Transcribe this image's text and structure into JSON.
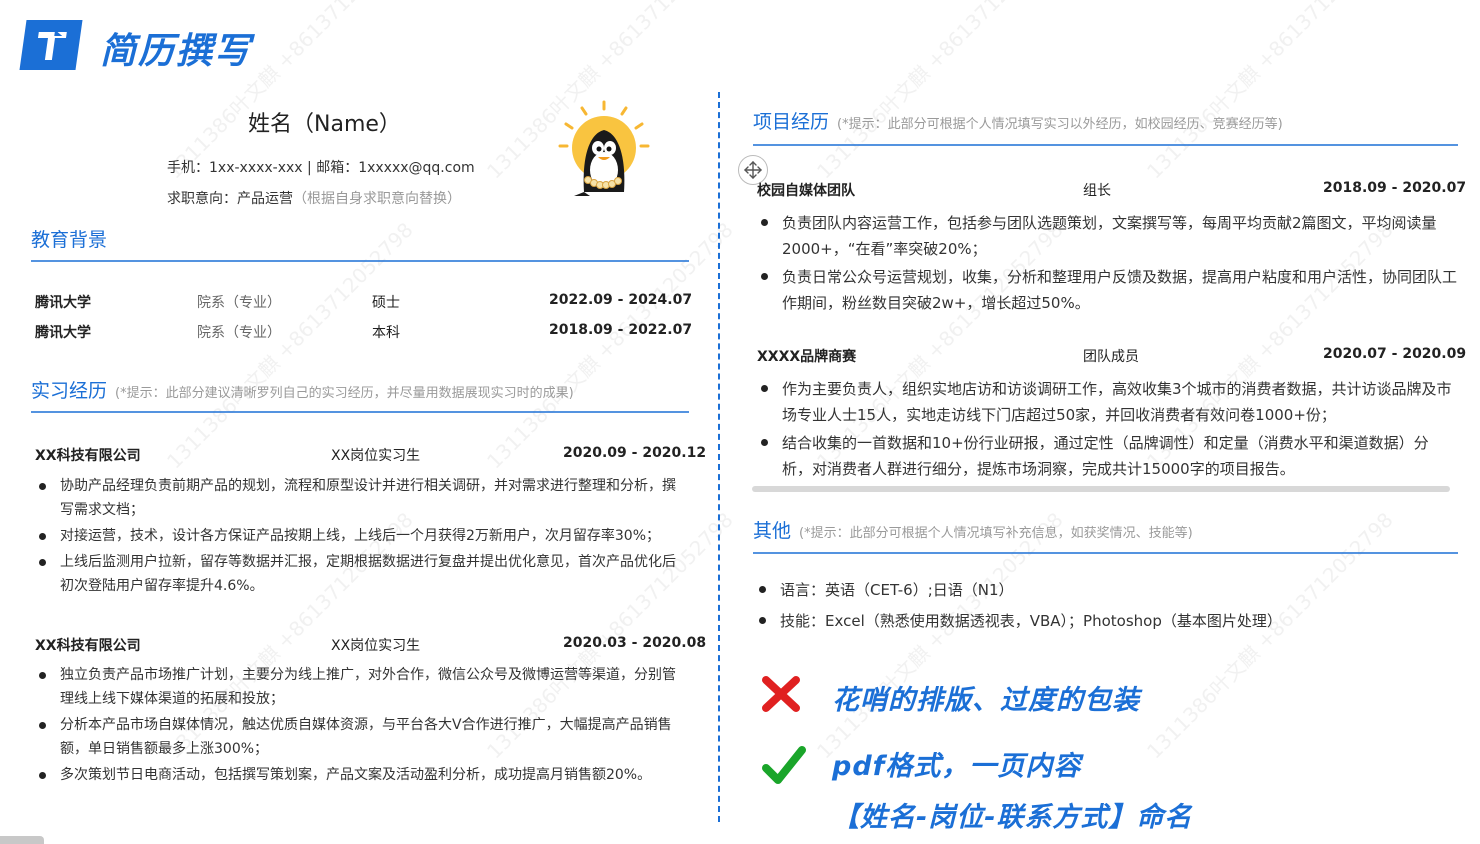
{
  "slide": {
    "title": "简历撰写"
  },
  "resume": {
    "name": "姓名（Name）",
    "contact": "手机：1xx-xxxx-xxx | 邮箱：1xxxxx@qq.com",
    "objective_label": "求职意向：产品运营",
    "objective_hint": "（根据自身求职意向替换）"
  },
  "education": {
    "title": "教育背景",
    "rows": [
      {
        "school": "腾讯大学",
        "dept": "院系（专业）",
        "degree": "硕士",
        "dates": "2022.09 - 2024.07"
      },
      {
        "school": "腾讯大学",
        "dept": "院系（专业）",
        "degree": "本科",
        "dates": "2018.09 - 2022.07"
      }
    ]
  },
  "internship": {
    "title": "实习经历",
    "hint": "(*提示：此部分建议清晰罗列自己的实习经历，并尽量用数据展现实习时的成果)",
    "entries": [
      {
        "company": "XX科技有限公司",
        "role": "XX岗位实习生",
        "dates": "2020.09 - 2020.12",
        "bullets": [
          "协助产品经理负责前期产品的规划，流程和原型设计并进行相关调研，并对需求进行整理和分析，撰写需求文档；",
          "对接运营，技术，设计各方保证产品按期上线，上线后一个月获得2万新用户，次月留存率30%；",
          "上线后监测用户拉新，留存等数据并汇报，定期根据数据进行复盘并提出优化意见，首次产品优化后初次登陆用户留存率提升4.6%。"
        ]
      },
      {
        "company": "XX科技有限公司",
        "role": "XX岗位实习生",
        "dates": "2020.03 - 2020.08",
        "bullets": [
          "独立负责产品市场推广计划，主要分为线上推广，对外合作，微信公众号及微博运营等渠道，分别管理线上线下媒体渠道的拓展和投放；",
          "分析本产品市场自媒体情况，触达优质自媒体资源，与平台各大V合作进行推广，大幅提高产品销售额，单日销售额最多上涨300%；",
          "多次策划节日电商活动，包括撰写策划案，产品文案及活动盈利分析，成功提高月销售额20%。"
        ]
      }
    ]
  },
  "projects": {
    "title": "项目经历",
    "hint": "(*提示：此部分可根据个人情况填写实习以外经历，如校园经历、竞赛经历等)",
    "entries": [
      {
        "name": "校园自媒体团队",
        "role": "组长",
        "dates": "2018.09 - 2020.07",
        "bullets": [
          "负责团队内容运营工作，包括参与团队选题策划，文案撰写等，每周平均贡献2篇图文，平均阅读量2000+，“在看”率突破20%；",
          "负责日常公众号运营规划，收集，分析和整理用户反馈及数据，提高用户粘度和用户活性，协同团队工作期间，粉丝数目突破2w+，增长超过50%。"
        ]
      },
      {
        "name": "XXXX品牌商赛",
        "role": "团队成员",
        "dates": "2020.07 - 2020.09",
        "bullets": [
          "作为主要负责人，组织实地店访和访谈调研工作，高效收集3个城市的消费者数据，共计访谈品牌及市场专业人士15人，实地走访线下门店超过50家，并回收消费者有效问卷1000+份；",
          "结合收集的一首数据和10+份行业研报，通过定性（品牌调性）和定量（消费水平和渠道数据）分析，对消费者人群进行细分，提炼市场洞察，完成共计15000字的项目报告。"
        ]
      }
    ]
  },
  "other": {
    "title": "其他",
    "hint": "(*提示：此部分可根据个人情况填写补充信息，如获奖情况、技能等)",
    "bullets": [
      "语言：英语（CET-6）;日语（N1）",
      "技能：Excel（熟悉使用数据透视表，VBA）；Photoshop（基本图片处理）"
    ]
  },
  "annotations": {
    "bad": "花哨的排版、过度的包装",
    "good_1": "pdf格式，一页内容",
    "good_2": "【姓名-岗位-联系方式】命名"
  },
  "watermark": "1311386叶文麒 +8613712052798",
  "colors": {
    "accent": "#1b6fd6",
    "bad": "#e02020",
    "good": "#1aa52a"
  },
  "icons": {
    "cross": "cross-icon",
    "check": "check-icon",
    "move": "move-icon"
  }
}
